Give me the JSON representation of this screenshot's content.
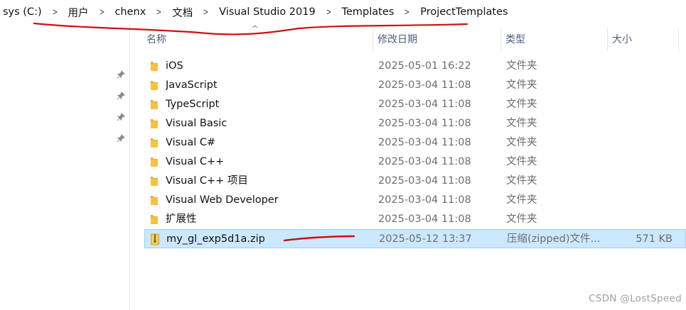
{
  "breadcrumb": [
    "sys (C:)",
    "用户",
    "chenx",
    "文档",
    "Visual Studio 2019",
    "Templates",
    "ProjectTemplates"
  ],
  "columns": {
    "name": "名称",
    "date": "修改日期",
    "type": "类型",
    "size": "大小"
  },
  "sort_indicator": "^",
  "rows": [
    {
      "name": "iOS",
      "date": "2025-05-01 16:22",
      "type": "文件夹",
      "size": "",
      "icon": "folder-icon"
    },
    {
      "name": "JavaScript",
      "date": "2025-03-04 11:08",
      "type": "文件夹",
      "size": "",
      "icon": "folder-icon"
    },
    {
      "name": "TypeScript",
      "date": "2025-03-04 11:08",
      "type": "文件夹",
      "size": "",
      "icon": "folder-icon"
    },
    {
      "name": "Visual Basic",
      "date": "2025-03-04 11:08",
      "type": "文件夹",
      "size": "",
      "icon": "folder-icon"
    },
    {
      "name": "Visual C#",
      "date": "2025-03-04 11:08",
      "type": "文件夹",
      "size": "",
      "icon": "folder-icon"
    },
    {
      "name": "Visual C++",
      "date": "2025-03-04 11:08",
      "type": "文件夹",
      "size": "",
      "icon": "folder-icon"
    },
    {
      "name": "Visual C++ 项目",
      "date": "2025-03-04 11:08",
      "type": "文件夹",
      "size": "",
      "icon": "folder-icon"
    },
    {
      "name": "Visual Web Developer",
      "date": "2025-03-04 11:08",
      "type": "文件夹",
      "size": "",
      "icon": "folder-icon"
    },
    {
      "name": "扩展性",
      "date": "2025-03-04 11:08",
      "type": "文件夹",
      "size": "",
      "icon": "folder-icon"
    },
    {
      "name": "my_gl_exp5d1a.zip",
      "date": "2025-05-12 13:37",
      "type": "压缩(zipped)文件...",
      "size": "571 KB",
      "icon": "zip-file-icon",
      "selected": true
    }
  ],
  "watermark": "CSDN @LostSpeed",
  "colors": {
    "selection_bg": "#cce8ff",
    "selection_border": "#99d1ff",
    "annotation": "#cc1111",
    "folder": "#f5c242"
  }
}
